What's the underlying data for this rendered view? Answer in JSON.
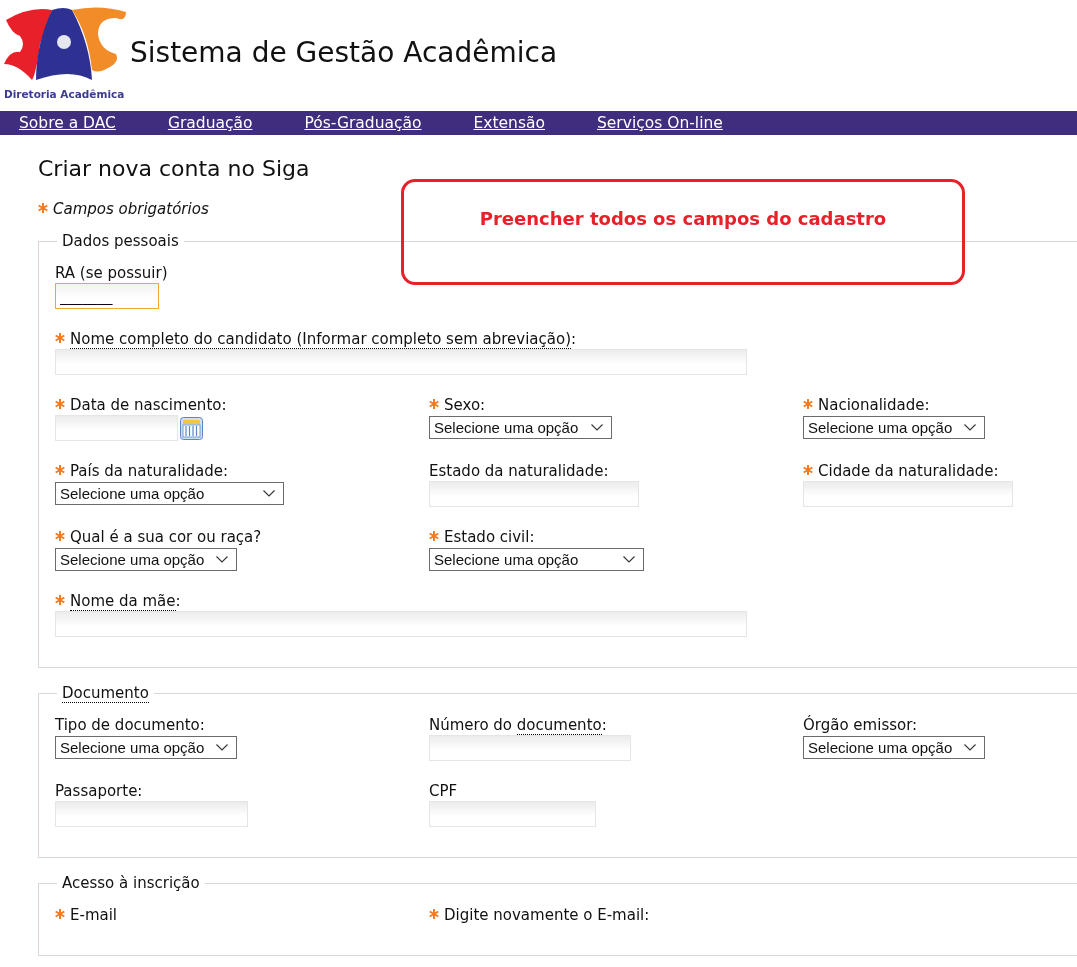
{
  "header": {
    "logo_caption": "Diretoria Acadêmica",
    "title": "Sistema de Gestão Acadêmica"
  },
  "nav": [
    "Sobre a DAC",
    "Graduação",
    "Pós-Graduação",
    "Extensão",
    "Serviços On-line"
  ],
  "page_title": "Criar nova conta no Siga",
  "required_note": "Campos obrigatórios",
  "callout": "Preencher todos os campos do cadastro",
  "sections": [
    {
      "legend": [
        {
          "text": "Dados pessoais",
          "dotted": false
        }
      ],
      "rows": [
        [
          {
            "kind": "text",
            "required": false,
            "focused": true,
            "label": [
              {
                "text": "RA (se possuir)",
                "dotted": false
              }
            ],
            "value": "_______"
          }
        ],
        [
          {
            "kind": "text",
            "required": true,
            "focused": false,
            "label": [
              {
                "text": "Nome completo do candidato (Informar completo sem abreviação)",
                "dotted": true
              },
              {
                "text": ":",
                "dotted": false
              }
            ]
          }
        ],
        [
          {
            "kind": "date",
            "required": true,
            "focused": false,
            "label": [
              {
                "text": "Data de nascimento:",
                "dotted": false
              }
            ]
          },
          {
            "kind": "select",
            "required": true,
            "label": [
              {
                "text": "Sexo:",
                "dotted": false
              }
            ],
            "value": "Selecione uma opção"
          },
          {
            "kind": "select",
            "required": true,
            "label": [
              {
                "text": "Nacionalidade:",
                "dotted": false
              }
            ],
            "value": "Selecione uma opção"
          }
        ],
        [
          {
            "kind": "select",
            "required": true,
            "label": [
              {
                "text": "País da naturalidade:",
                "dotted": false
              }
            ],
            "value": "Selecione uma opção"
          },
          {
            "kind": "text",
            "required": false,
            "focused": false,
            "label": [
              {
                "text": "Estado da naturalidade:",
                "dotted": false
              }
            ]
          },
          {
            "kind": "text",
            "required": true,
            "focused": false,
            "label": [
              {
                "text": "Cidade da naturalidade:",
                "dotted": false
              }
            ]
          }
        ],
        [
          {
            "kind": "select",
            "required": true,
            "label": [
              {
                "text": "Qual é a sua cor ou raça?",
                "dotted": false
              }
            ],
            "value": "Selecione uma opção"
          },
          {
            "kind": "select",
            "required": true,
            "label": [
              {
                "text": "Estado civil:",
                "dotted": false
              }
            ],
            "value": "Selecione uma opção"
          }
        ],
        [
          {
            "kind": "text",
            "required": true,
            "focused": false,
            "label": [
              {
                "text": "Nome da mãe",
                "dotted": true
              },
              {
                "text": ":",
                "dotted": false
              }
            ]
          }
        ]
      ]
    },
    {
      "legend": [
        {
          "text": "Documento",
          "dotted": true
        }
      ],
      "rows": [
        [
          {
            "kind": "select",
            "required": false,
            "label": [
              {
                "text": "Tipo de documento:",
                "dotted": false
              }
            ],
            "value": "Selecione uma opção"
          },
          {
            "kind": "text",
            "required": false,
            "focused": false,
            "label": [
              {
                "text": "Número do ",
                "dotted": false
              },
              {
                "text": "documento",
                "dotted": true
              },
              {
                "text": ":",
                "dotted": false
              }
            ]
          },
          {
            "kind": "select",
            "required": false,
            "label": [
              {
                "text": "Órgão emissor:",
                "dotted": false
              }
            ],
            "value": "Selecione uma opção"
          }
        ],
        [
          {
            "kind": "text",
            "required": false,
            "focused": false,
            "label": [
              {
                "text": "Passaporte:",
                "dotted": false
              }
            ]
          },
          {
            "kind": "text",
            "required": false,
            "focused": false,
            "label": [
              {
                "text": "CPF",
                "dotted": false
              }
            ]
          }
        ]
      ]
    },
    {
      "legend": [
        {
          "text": "Acesso à inscrição",
          "dotted": false
        }
      ],
      "rows": [
        [
          {
            "kind": "label",
            "required": true,
            "label": [
              {
                "text": "E-mail",
                "dotted": false
              }
            ]
          },
          {
            "kind": "label",
            "required": true,
            "label": [
              {
                "text": "Digite novamente o E-mail:",
                "dotted": false
              }
            ]
          }
        ]
      ]
    }
  ]
}
